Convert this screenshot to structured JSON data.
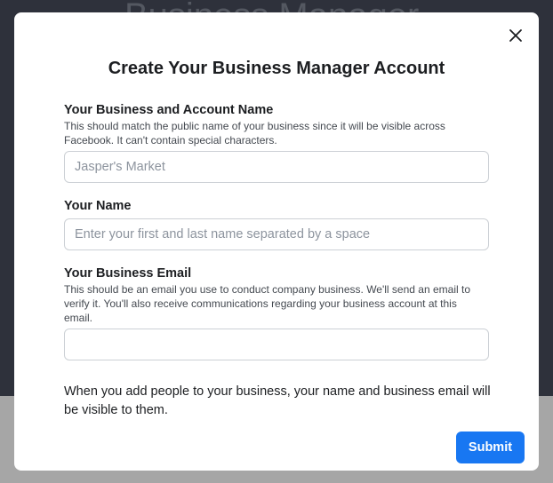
{
  "backdrop": {
    "heading": "Business Manager"
  },
  "modal": {
    "title": "Create Your Business Manager Account",
    "close_icon": "close-icon",
    "fields": {
      "business_name": {
        "label": "Your Business and Account Name",
        "help": "This should match the public name of your business since it will be visible across Facebook. It can't contain special characters.",
        "placeholder": "Jasper's Market",
        "value": ""
      },
      "your_name": {
        "label": "Your Name",
        "placeholder": "Enter your first and last name separated by a space",
        "value": ""
      },
      "business_email": {
        "label": "Your Business Email",
        "help": "This should be an email you use to conduct company business. We'll send an email to verify it. You'll also receive communications regarding your business account at this email.",
        "placeholder": "",
        "value": ""
      }
    },
    "notice": "When you add people to your business, your name and business email will be visible to them.",
    "submit_label": "Submit"
  },
  "colors": {
    "primary": "#1877f2",
    "backdrop_dark": "#2e313b",
    "backdrop_light": "#a6a6a6",
    "input_border": "#ccd0d5",
    "text": "#1c1e21"
  }
}
